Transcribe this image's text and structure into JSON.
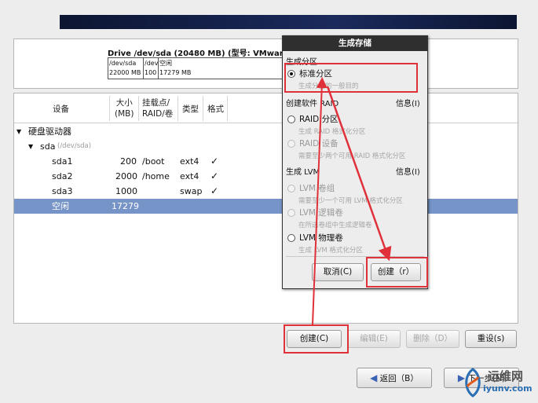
{
  "drive": {
    "title": "Drive /dev/sda (20480 MB) (型号: VMware",
    "segments": [
      {
        "name": "/dev/sda",
        "size": "22000 MB"
      },
      {
        "name": "/dev",
        "size": "100"
      },
      {
        "name": "空闲",
        "size": "17279 MB"
      }
    ]
  },
  "table": {
    "headers": {
      "device": "设备",
      "size": "大小\n(MB)",
      "mount": "挂载点/\nRAID/卷",
      "type": "类型",
      "format": "格式"
    },
    "group": "硬盘驱动器",
    "disk": "sda",
    "disk_path": "(/dev/sda)",
    "rows": [
      {
        "name": "sda1",
        "size": "200",
        "mount": "/boot",
        "type": "ext4",
        "format": "✓"
      },
      {
        "name": "sda2",
        "size": "2000",
        "mount": "/home",
        "type": "ext4",
        "format": "✓"
      },
      {
        "name": "sda3",
        "size": "1000",
        "mount": "",
        "type": "swap",
        "format": "✓"
      },
      {
        "name": "空闲",
        "size": "17279",
        "mount": "",
        "type": "",
        "format": ""
      }
    ]
  },
  "buttons": {
    "create": "创建(C)",
    "edit": "编辑(E)",
    "delete": "删除（D）",
    "reset": "重设(s)",
    "back": "返回（B）",
    "next": "下一步(N)"
  },
  "dialog": {
    "title": "生成存储",
    "section_partition": "生成分区",
    "standard_partition": "标准分区",
    "standard_partition_desc": "生成分区的一般目的",
    "section_raid": "创建软件 RAID",
    "info1": "信息(I)",
    "raid_partition": "RAID 分区",
    "raid_partition_desc": "生成 RAID 格式化分区",
    "raid_device": "RAID 设备",
    "raid_device_desc": "需要至少两个可用 RAID 格式化分区",
    "section_lvm": "生成 LVM",
    "info2": "信息(I)",
    "lvm_group": "LVM 卷组",
    "lvm_group_desc": "需要至少一个可用 LVM 格式化分区",
    "lvm_lv": "LVM 逻辑卷",
    "lvm_lv_desc": "在所选卷组中生成逻辑卷",
    "lvm_pv": "LVM 物理卷",
    "lvm_pv_desc": "生成 LVM 格式化分区",
    "cancel": "取消(C)",
    "create": "创建（r）"
  },
  "watermark": {
    "cn": "运维网",
    "en": "iyunv.com"
  },
  "colors": {
    "selection": "#7694c7",
    "highlight": "#e0313a",
    "topbar": "#111a3a"
  }
}
